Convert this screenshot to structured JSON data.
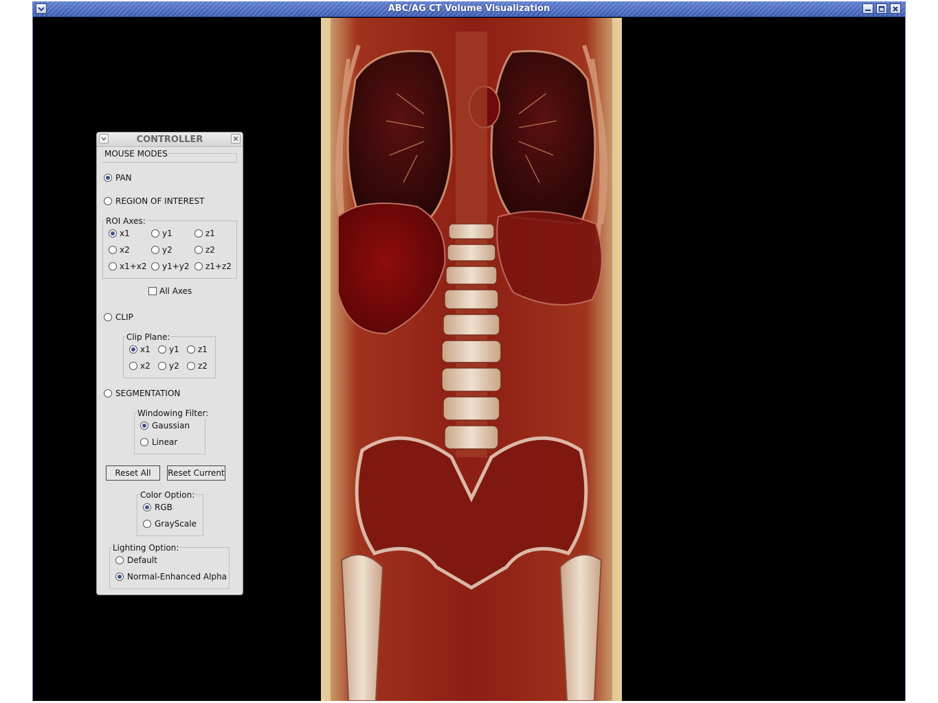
{
  "window": {
    "title": "ABC/AG CT Volume Visualization"
  },
  "controller": {
    "title": "CONTROLLER",
    "mouse_modes_label": "MOUSE MODES",
    "modes": {
      "pan": "PAN",
      "roi": "REGION OF INTEREST",
      "clip": "CLIP",
      "segmentation": "SEGMENTATION"
    },
    "selected_mode": "PAN",
    "roi_axes": {
      "label": "ROI Axes:",
      "options": [
        "x1",
        "y1",
        "z1",
        "x2",
        "y2",
        "z2",
        "x1+x2",
        "y1+y2",
        "z1+z2"
      ],
      "selected": "x1"
    },
    "all_axes": {
      "label": "All Axes",
      "checked": false
    },
    "clip_plane": {
      "label": "Clip Plane:",
      "options": [
        "x1",
        "y1",
        "z1",
        "x2",
        "y2",
        "z2"
      ],
      "selected": "x1"
    },
    "windowing_filter": {
      "label": "Windowing Filter:",
      "options": [
        "Gaussian",
        "Linear"
      ],
      "selected": "Gaussian"
    },
    "buttons": {
      "reset_all": "Reset All",
      "reset_current": "Reset Current"
    },
    "color_option": {
      "label": "Color Option:",
      "options": [
        "RGB",
        "GrayScale"
      ],
      "selected": "RGB"
    },
    "lighting_option": {
      "label": "Lighting Option:",
      "options": [
        "Default",
        "Normal-Enhanced Alpha"
      ],
      "selected": "Normal-Enhanced Alpha"
    }
  },
  "colors": {
    "titlebar_blue": "#4a6bc0",
    "panel_gray": "#e2e2e2",
    "radio_fill": "#3e4f8e",
    "tissue_red": "#8a1212",
    "bone_cream": "#e8d3a0"
  },
  "icons": {
    "menu": "chevron-down-icon",
    "minimize": "minimize-icon",
    "maximize": "maximize-icon",
    "close": "close-icon"
  }
}
